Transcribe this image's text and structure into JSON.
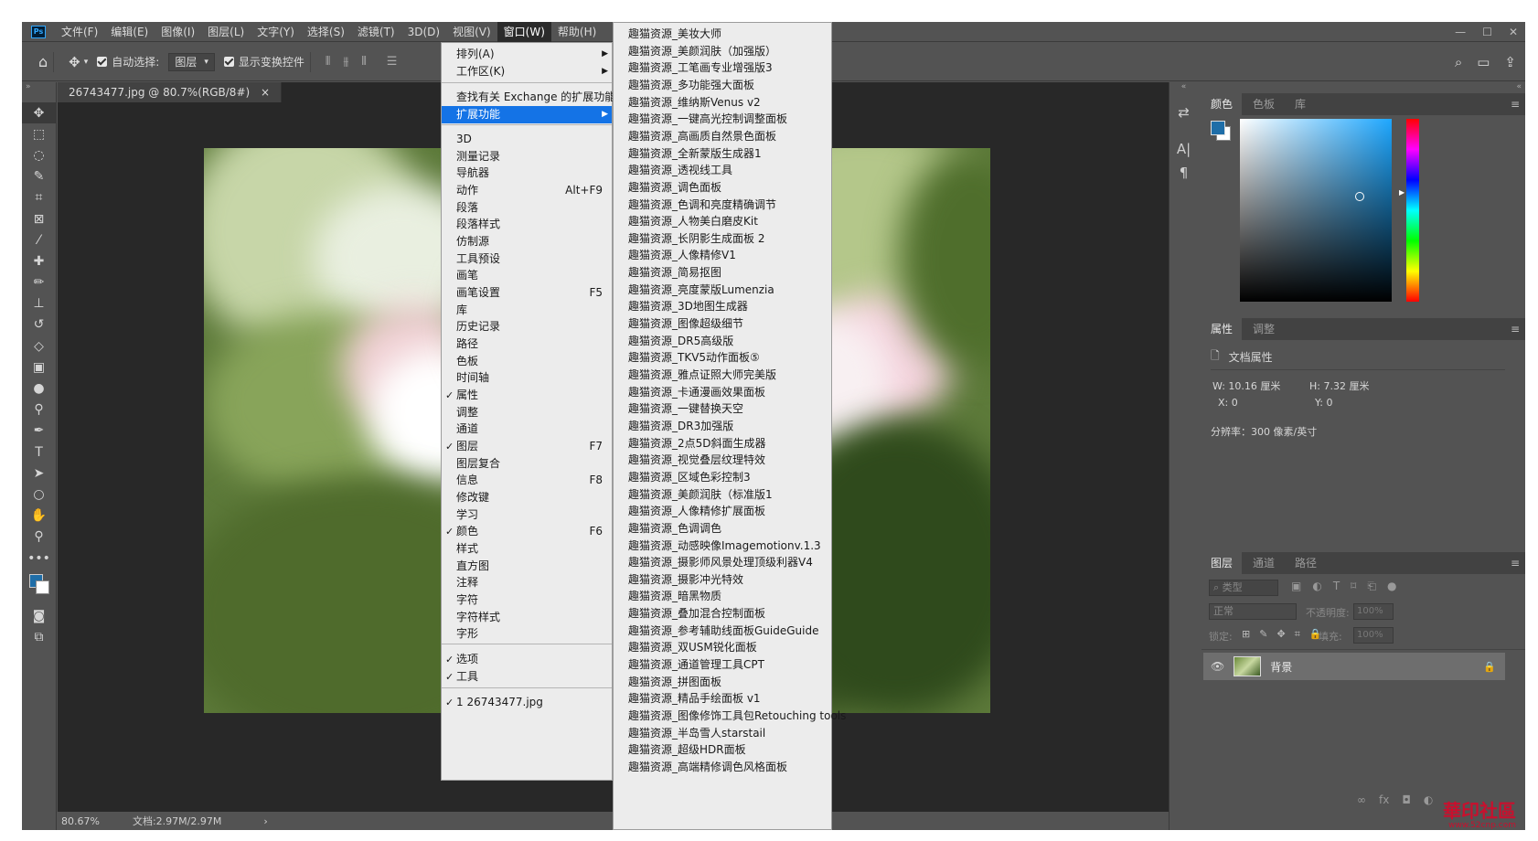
{
  "menubar": {
    "items": [
      "文件(F)",
      "编辑(E)",
      "图像(I)",
      "图层(L)",
      "文字(Y)",
      "选择(S)",
      "滤镜(T)",
      "3D(D)",
      "视图(V)",
      "窗口(W)",
      "帮助(H)"
    ],
    "active": "窗口(W)",
    "logo": "Ps"
  },
  "options": {
    "auto_select_label": "自动选择:",
    "layer_select": "图层",
    "show_transform_label": "显示变换控件"
  },
  "document": {
    "tab_title": "26743477.jpg @ 80.7%(RGB/8#)",
    "close": "×"
  },
  "status": {
    "zoom": "80.67%",
    "doc": "文档:2.97M/2.97M"
  },
  "window_menu": {
    "items": [
      {
        "label": "排列(A)",
        "arrow": true
      },
      {
        "label": "工作区(K)",
        "arrow": true
      },
      {
        "label": "查找有关 Exchange 的扩展功能..."
      },
      {
        "label": "扩展功能",
        "arrow": true,
        "highlight": true
      },
      {
        "label": "3D"
      },
      {
        "label": "测量记录"
      },
      {
        "label": "导航器"
      },
      {
        "label": "动作",
        "shortcut": "Alt+F9"
      },
      {
        "label": "段落"
      },
      {
        "label": "段落样式"
      },
      {
        "label": "仿制源"
      },
      {
        "label": "工具预设"
      },
      {
        "label": "画笔"
      },
      {
        "label": "画笔设置",
        "shortcut": "F5"
      },
      {
        "label": "库"
      },
      {
        "label": "历史记录"
      },
      {
        "label": "路径"
      },
      {
        "label": "色板"
      },
      {
        "label": "时间轴"
      },
      {
        "label": "属性",
        "checked": true
      },
      {
        "label": "调整"
      },
      {
        "label": "通道"
      },
      {
        "label": "图层",
        "checked": true,
        "shortcut": "F7"
      },
      {
        "label": "图层复合"
      },
      {
        "label": "信息",
        "shortcut": "F8"
      },
      {
        "label": "修改键"
      },
      {
        "label": "学习"
      },
      {
        "label": "颜色",
        "checked": true,
        "shortcut": "F6"
      },
      {
        "label": "样式"
      },
      {
        "label": "直方图"
      },
      {
        "label": "注释"
      },
      {
        "label": "字符"
      },
      {
        "label": "字符样式"
      },
      {
        "label": "字形"
      },
      {
        "label": "选项",
        "checked": true
      },
      {
        "label": "工具",
        "checked": true
      },
      {
        "label": "1 26743477.jpg",
        "checked": true
      }
    ]
  },
  "extensions_menu": {
    "items": [
      "趣猫资源_美妆大师",
      "趣猫资源_美颜润肤（加强版）",
      "趣猫资源_工笔画专业增强版3",
      "趣猫资源_多功能强大面板",
      "趣猫资源_维纳斯Venus v2",
      "趣猫资源_一键高光控制调整面板",
      "趣猫资源_高画质自然景色面板",
      "趣猫资源_全新蒙版生成器1",
      "趣猫资源_透视线工具",
      "趣猫资源_调色面板",
      "趣猫资源_色调和亮度精确调节",
      "趣猫资源_人物美白磨皮Kit",
      "趣猫资源_长阴影生成面板 2",
      "趣猫资源_人像精修V1",
      "趣猫资源_简易抠图",
      "趣猫资源_亮度蒙版Lumenzia",
      "趣猫资源_3D地图生成器",
      "趣猫资源_图像超级细节",
      "趣猫资源_DR5高级版",
      "趣猫资源_TKV5动作面板⑤",
      "趣猫资源_雅点证照大师完美版",
      "趣猫资源_卡通漫画效果面板",
      "趣猫资源_一键替换天空",
      "趣猫资源_DR3加强版",
      "趣猫资源_2点5D斜面生成器",
      "趣猫资源_视觉叠层纹理特效",
      "趣猫资源_区域色彩控制3",
      "趣猫资源_美颜润肤（标准版1",
      "趣猫资源_人像精修扩展面板",
      "趣猫资源_色调调色",
      "趣猫资源_动感映像Imagemotionv.1.3",
      "趣猫资源_摄影师风景处理顶级利器V4",
      "趣猫资源_摄影冲光特效",
      "趣猫资源_暗黑物质",
      "趣猫资源_叠加混合控制面板",
      "趣猫资源_参考辅助线面板GuideGuide",
      "趣猫资源_双USM锐化面板",
      "趣猫资源_通道管理工具CPT",
      "趣猫资源_拼图面板",
      "趣猫资源_精品手绘面板 v1",
      "趣猫资源_图像修饰工具包Retouching tools",
      "趣猫资源_半岛雪人starstail",
      "趣猫资源_超级HDR面板",
      "趣猫资源_高端精修调色风格面板"
    ]
  },
  "color_panel": {
    "tabs": [
      "颜色",
      "色板",
      "库"
    ],
    "fg_color": "#1f6ea8"
  },
  "properties_panel": {
    "tabs": [
      "属性",
      "调整"
    ],
    "doc_props": "文档属性",
    "w": "W:  10.16 厘米",
    "h": "H:  7.32 厘米",
    "x": "X:  0",
    "y": "Y:  0",
    "resolution": "分辨率：300 像素/英寸"
  },
  "layers_panel": {
    "tabs": [
      "图层",
      "通道",
      "路径"
    ],
    "search_placeholder": "类型",
    "blend_mode": "正常",
    "opacity_label": "不透明度:",
    "opacity_value": "100%",
    "lock_label": "锁定:",
    "fill_label": "填充:",
    "fill_value": "100%",
    "layer_name": "背景"
  },
  "watermark": {
    "text": "華印社區",
    "url": "www.52cnp.com"
  }
}
